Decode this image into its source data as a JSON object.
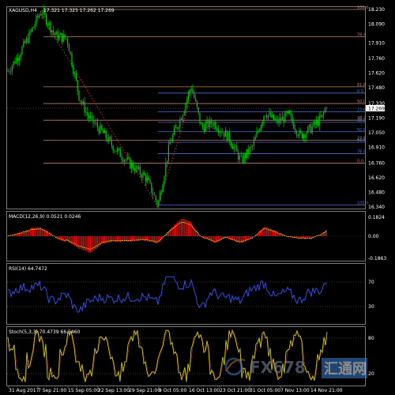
{
  "header": {
    "symbol": "XAGUSD,H4",
    "ohlc": "17.321 17.325 17.262 17.269"
  },
  "price_axis": {
    "labels": [
      "18.230",
      "18.090",
      "17.910",
      "17.760",
      "17.620",
      "17.480",
      "17.330",
      "17.190",
      "17.050",
      "16.910",
      "16.760",
      "16.620",
      "16.480",
      "16.340"
    ],
    "current_price": "17.269"
  },
  "fib_upper": {
    "labels": [
      "100.0",
      "76.4",
      "61.8",
      "50.0",
      "38.2",
      "23.6",
      "0.0"
    ],
    "levels": [
      18.23,
      17.97,
      17.49,
      17.33,
      17.17,
      16.98,
      16.76
    ]
  },
  "fib_lower": {
    "labels": [
      "0.0",
      "23.6",
      "38.2",
      "50.0",
      "61.8",
      "76.4",
      "100.0"
    ],
    "levels": [
      17.43,
      17.25,
      17.15,
      17.06,
      16.96,
      16.85,
      16.36
    ]
  },
  "macd": {
    "title": "MACD(12,26,9) 0.0521 0.0246",
    "scale": [
      "0.1824",
      "0.00",
      "-0.1863"
    ]
  },
  "rsi": {
    "title": "RSI(14) 64.7472",
    "scale": [
      "70",
      "30"
    ]
  },
  "stoch": {
    "title": "Stoch(5,3,3) 70.4739 66.5460",
    "scale": [
      "80",
      "20"
    ]
  },
  "time_axis": [
    "31 Aug 2017",
    "7 Sep 21:00",
    "15 Sep 05:00",
    "22 Sep 13:00",
    "29 Sep 21:00",
    "9 Oct 05:00",
    "16 Oct 13:00",
    "23 Oct 21:00",
    "31 Oct 05:00",
    "7 Nov 13:00",
    "14 Nov 21:00"
  ],
  "watermark": {
    "brand": "FX678",
    "cn": "汇通网"
  },
  "colors": {
    "background": "#000000",
    "candle": "#00cc00",
    "grid_line": "#4a5a7a",
    "fib_upper": "#c08060",
    "fib_lower": "#4a6fd6",
    "macd_hist": "#dd1111",
    "signal": "#ffff00",
    "rsi": "#3355ff",
    "stoch_main": "#cccc00",
    "stoch_signal": "#ff3333"
  }
}
